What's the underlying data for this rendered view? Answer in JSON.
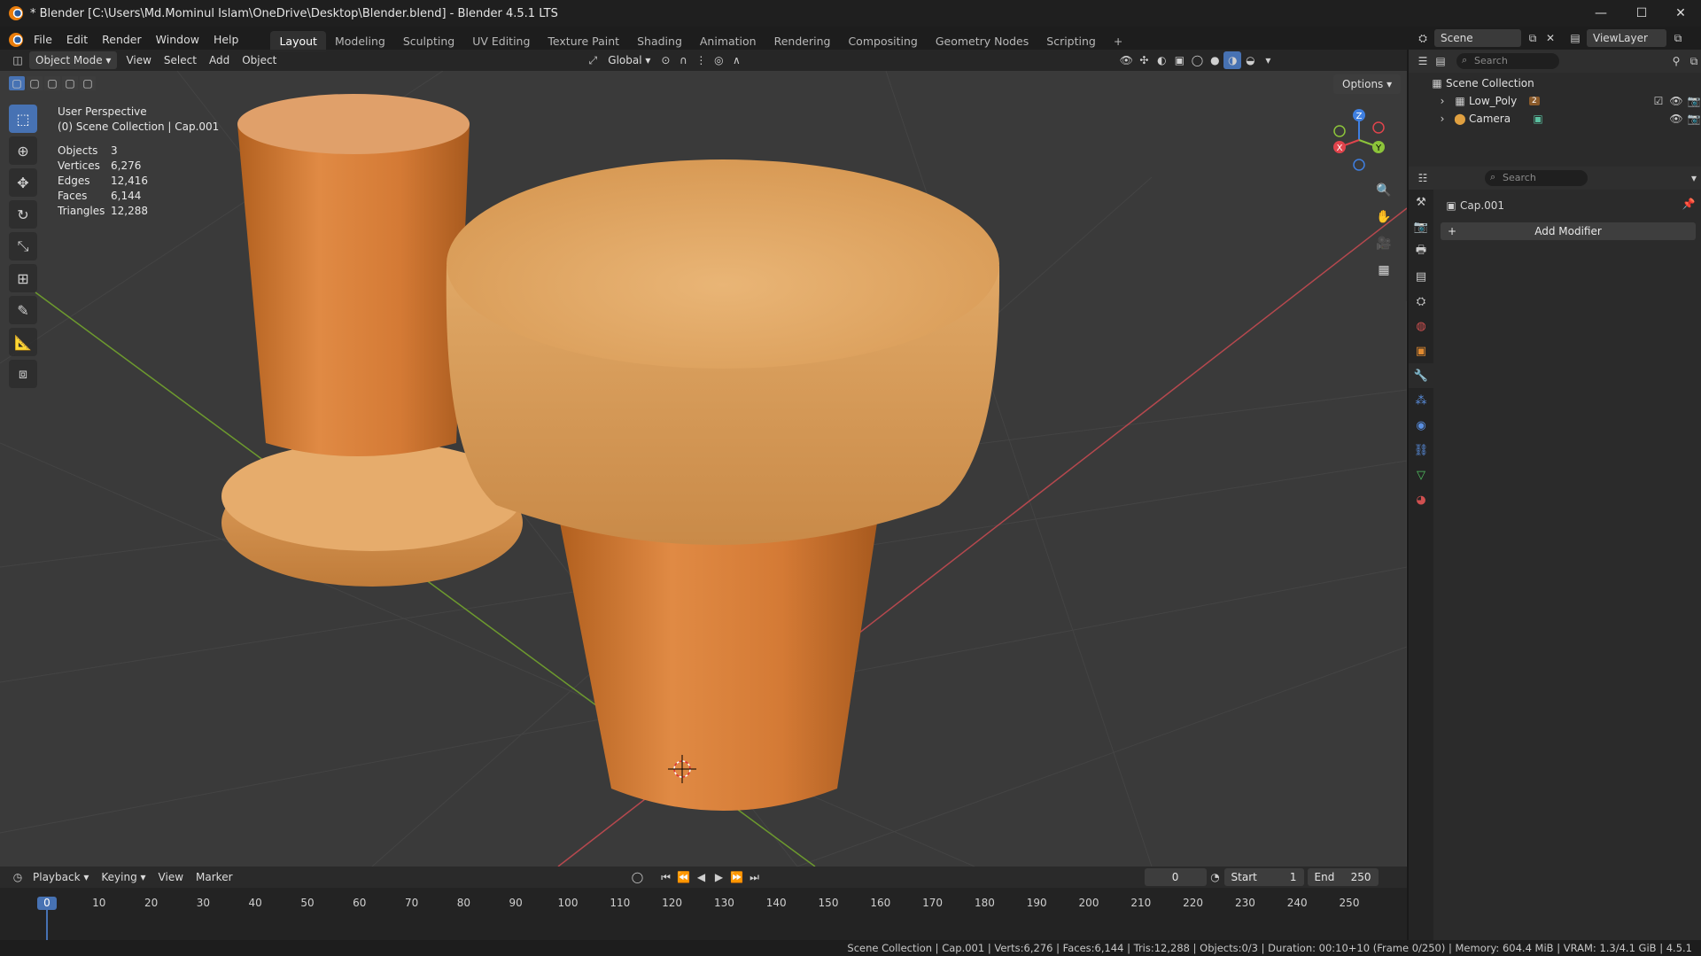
{
  "window": {
    "title": "* Blender [C:\\Users\\Md.Mominul Islam\\OneDrive\\Desktop\\Blender.blend] - Blender 4.5.1 LTS",
    "minimize": "—",
    "maximize": "☐",
    "close": "✕"
  },
  "menu": [
    "File",
    "Edit",
    "Render",
    "Window",
    "Help"
  ],
  "workspaces": [
    "Layout",
    "Modeling",
    "Sculpting",
    "UV Editing",
    "Texture Paint",
    "Shading",
    "Animation",
    "Rendering",
    "Compositing",
    "Geometry Nodes",
    "Scripting"
  ],
  "workspace_add": "+",
  "viewport_header": {
    "mode": "Object Mode",
    "menus": [
      "View",
      "Select",
      "Add",
      "Object"
    ],
    "transform_orientation": "Global",
    "options": "Options"
  },
  "overlay_text": {
    "perspective": "User Perspective",
    "collection": "(0) Scene Collection | Cap.001"
  },
  "stats": [
    {
      "k": "Objects",
      "v": "3"
    },
    {
      "k": "Vertices",
      "v": "6,276"
    },
    {
      "k": "Edges",
      "v": "12,416"
    },
    {
      "k": "Faces",
      "v": "6,144"
    },
    {
      "k": "Triangles",
      "v": "12,288"
    }
  ],
  "gizmo": {
    "z": "Z",
    "y": "Y",
    "x": "X"
  },
  "scene": {
    "name": "Scene",
    "view_layer": "ViewLayer"
  },
  "outliner": {
    "search_placeholder": "Search",
    "root": "Scene Collection",
    "items": [
      {
        "name": "Low_Poly",
        "badge": "2"
      },
      {
        "name": "Camera"
      }
    ]
  },
  "properties": {
    "search_placeholder": "Search",
    "object_name": "Cap.001",
    "add_modifier": "Add Modifier"
  },
  "timeline": {
    "menus": [
      "Playback",
      "Keying",
      "View",
      "Marker"
    ],
    "current_frame": "0",
    "start_label": "Start",
    "start": "1",
    "end_label": "End",
    "end": "250",
    "frames": [
      "0",
      "10",
      "20",
      "30",
      "40",
      "50",
      "60",
      "70",
      "80",
      "90",
      "100",
      "110",
      "120",
      "130",
      "140",
      "150",
      "160",
      "170",
      "180",
      "190",
      "200",
      "210",
      "220",
      "230",
      "240",
      "250"
    ]
  },
  "status_bar": "Scene Collection | Cap.001 | Verts:6,276 | Faces:6,144 | Tris:12,288 | Objects:0/3 | Duration: 00:10+10 (Frame 0/250) | Memory: 604.4 MiB | VRAM: 1.3/4.1 GiB | 4.5.1",
  "colors": {
    "accent": "#4772b3",
    "x_axis": "#e0444c",
    "y_axis": "#8cc43a",
    "z_axis": "#3f7fe0",
    "cork": "#d6813e",
    "cork_top": "#e6a864"
  }
}
